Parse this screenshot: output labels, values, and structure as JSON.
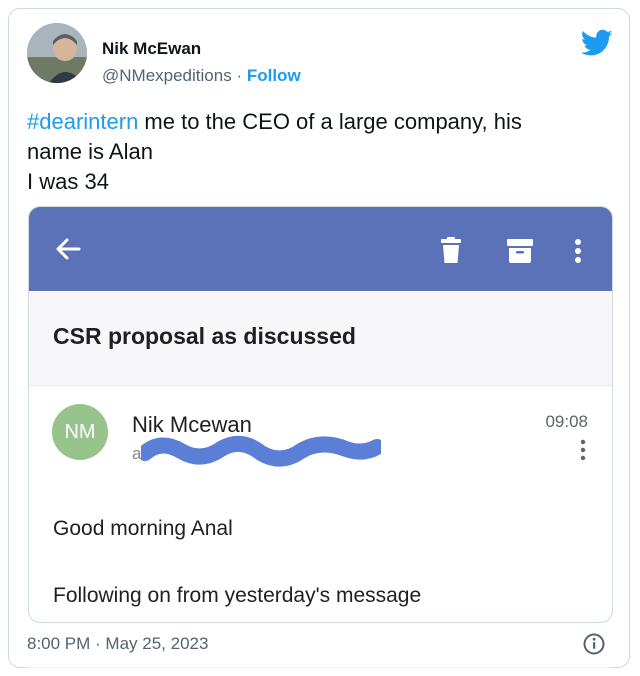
{
  "tweet": {
    "author_name": "Nik McEwan",
    "author_handle": "@NMexpeditions",
    "separator": "·",
    "follow_label": "Follow",
    "hashtag": "#dearintern",
    "text_line1_rest": " me to the CEO of a large company, his",
    "text_line2": "name is Alan",
    "text_line3": "I was 34",
    "timestamp": "8:00 PM · May 25, 2023",
    "brand_color": "#1d9bf0"
  },
  "email": {
    "subject": "CSR proposal as discussed",
    "sender_initials": "NM",
    "sender_name": "Nik Mcewan",
    "sender_email_visible": "al",
    "time": "09:08",
    "greeting": "Good morning Anal",
    "body_line": "Following on from yesterday's message",
    "appbar_color": "#5b72b9",
    "avatar_color": "#97c38d",
    "redaction_color": "#5b7fd6"
  },
  "icons": [
    "twitter-bird-icon",
    "back-arrow-icon",
    "trash-icon",
    "archive-icon",
    "more-vert-icon",
    "info-icon"
  ]
}
